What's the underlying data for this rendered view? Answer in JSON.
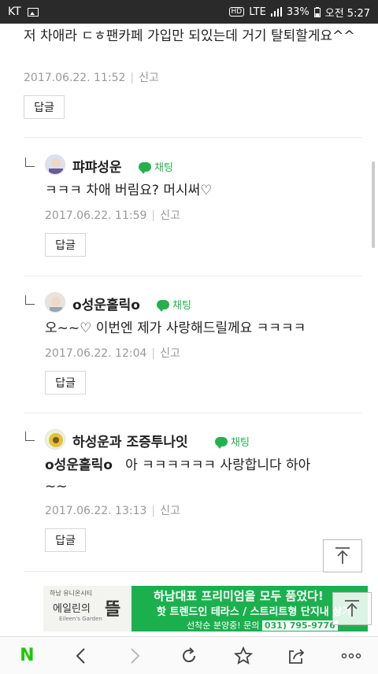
{
  "status_bar": {
    "carrier": "KT",
    "hd": "HD",
    "network": "LTE",
    "battery": "33%",
    "time": "오전 5:27"
  },
  "top_comment": {
    "text": "저 차애라 ㄷㅎ팬카페 가입만 되있는데 거기 탈퇴할게요^^",
    "date": "2017.06.22. 11:52",
    "report": "신고",
    "reply_label": "답글"
  },
  "replies": [
    {
      "nickname": "퍄퍄성운",
      "chat_label": "채팅",
      "text": "ㅋㅋㅋ 차애 버림요? 머시써♡",
      "date": "2017.06.22. 11:59",
      "report": "신고",
      "reply_label": "답글"
    },
    {
      "nickname": "o성운홀릭o",
      "chat_label": "채팅",
      "text": "오~~♡ 이번엔 제가 사랑해드릴께요 ㅋㅋㅋㅋ",
      "date": "2017.06.22. 12:04",
      "report": "신고",
      "reply_label": "답글"
    },
    {
      "nickname": "하성운과 조증투나잇",
      "chat_label": "채팅",
      "mention": "o성운홀릭o",
      "text": "아 ㅋㅋㅋㅋㅋㅋ 사랑합니다 하아",
      "text_cont": "~~",
      "date": "2017.06.22. 13:13",
      "report": "신고",
      "reply_label": "답글"
    }
  ],
  "ad": {
    "small_text": "하남 유니온시티",
    "brand": "에일린의",
    "brand_en": "Eileen's Garden",
    "brand_big": "뜰",
    "line1": "하남대표 프리미엄을 모두 품었다!",
    "line2": "핫 트렌드인 테라스 / 스트리트형 단지내 상가",
    "line3": "선착순 분양중! 문의",
    "phone": "031) 795-9776"
  },
  "colors": {
    "accent_green": "#24b14d",
    "ad_green": "#1bb04e",
    "naver_green": "#1ec800"
  },
  "nav": {
    "logo": "N"
  }
}
